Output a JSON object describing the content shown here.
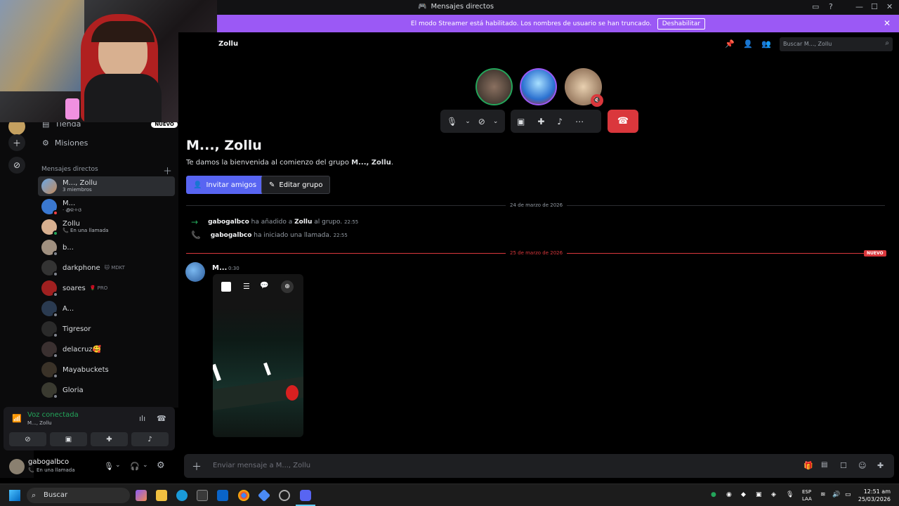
{
  "window": {
    "title": "Mensajes directos",
    "controls": [
      "inbox-icon",
      "help-icon",
      "minimize",
      "maximize",
      "close"
    ]
  },
  "streamer_banner": {
    "text": "El modo Streamer está habilitado. Los nombres de usuario se han truncado.",
    "button": "Deshabilitar"
  },
  "nav": {
    "shop_label": "Tienda",
    "shop_badge": "NUEVO",
    "quests_label": "Misiones"
  },
  "dm_list": {
    "header": "Mensajes directos",
    "items": [
      {
        "name": "M..., Zollu",
        "sub": "3 miembros",
        "active": true
      },
      {
        "name": "M...",
        "sub": "· ꩜ଳ✧ଓ",
        "status": "#f23f43"
      },
      {
        "name": "Zollu",
        "sub": "En una llamada",
        "status": "#23a55a"
      },
      {
        "name": "b...",
        "sub": "",
        "status": "#80848e"
      },
      {
        "name": "darkphone",
        "tag": "🐱 MDKT",
        "status": "#80848e"
      },
      {
        "name": "soares",
        "tag": "🌹 PRO",
        "status": "#80848e"
      },
      {
        "name": "A...",
        "sub": "",
        "status": "#80848e"
      },
      {
        "name": "Tigresor",
        "sub": "",
        "status": "#80848e"
      },
      {
        "name": "delacruz🥰",
        "sub": "",
        "status": "#80848e"
      },
      {
        "name": "Mayabuckets",
        "sub": "",
        "status": "#80848e"
      },
      {
        "name": "Gloria",
        "sub": "",
        "status": "#80848e"
      }
    ]
  },
  "voice": {
    "status": "Voz conectada",
    "channel": "M..., Zollu"
  },
  "user": {
    "name": "gabogalbco",
    "status": "En una llamada"
  },
  "header": {
    "group_name": "Zollu",
    "search_placeholder": "Buscar M..., Zollu"
  },
  "welcome": {
    "title": "M..., Zollu",
    "sub_prefix": "Te damos la bienvenida al comienzo del grupo ",
    "sub_bold": "M..., Zollu",
    "sub_suffix": ".",
    "invite_label": "Invitar amigos",
    "edit_label": "Editar grupo"
  },
  "divider1": "24 de marzo de 2026",
  "sys1": {
    "user": "gabogalbco",
    "mid": " ha añadido a ",
    "target": "Zollu",
    "end": " al grupo.",
    "time": "22:55"
  },
  "sys2": {
    "user": "gabogalbco",
    "mid": " ha iniciado una llamada.",
    "time": "22:55"
  },
  "divider2": "25 de marzo de 2026",
  "new_badge": "NUEVO",
  "message": {
    "author": "M...",
    "time": "0:30"
  },
  "composer": {
    "placeholder": "Enviar mensaje a M..., Zollu"
  },
  "taskbar": {
    "search": "Buscar",
    "lang1": "ESP",
    "lang2": "LAA",
    "time": "12:51 am",
    "date": "25/03/2026"
  },
  "colors": {
    "accent": "#5865f2",
    "streamer": "#9b59f5",
    "danger": "#da373c",
    "online": "#23a55a"
  }
}
